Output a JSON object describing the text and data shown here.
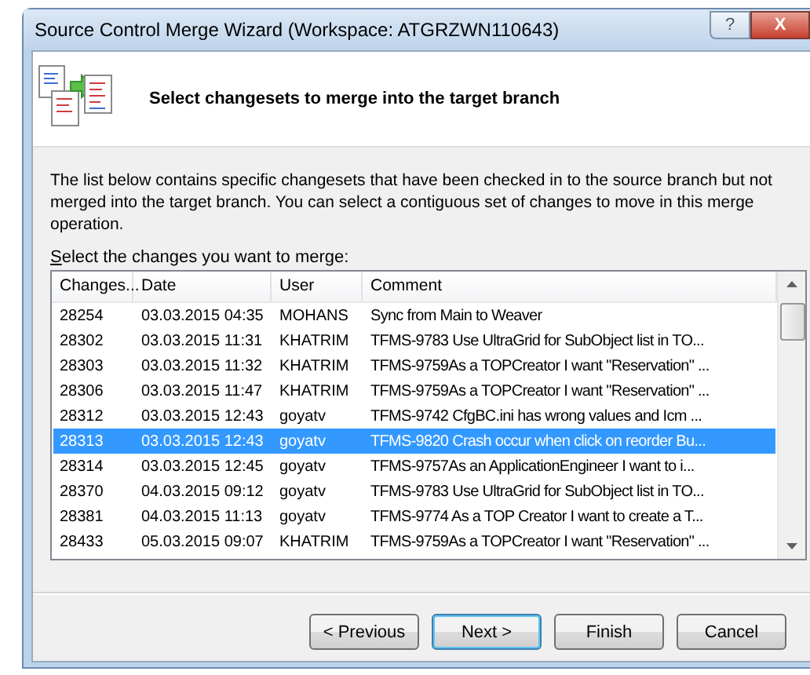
{
  "window": {
    "title": "Source Control Merge Wizard (Workspace: ATGRZWN110643)",
    "help_button": "?",
    "close_button": "X"
  },
  "header": {
    "title": "Select changesets to merge into the target branch"
  },
  "description": "The list below contains specific changesets that have been checked in to the source branch but not merged into the target branch. You can select a contiguous set of changes to move in this merge operation.",
  "list_label": "Select the changes you want to merge:",
  "table": {
    "columns": [
      "Changes...",
      "Date",
      "User",
      "Comment"
    ],
    "rows": [
      {
        "cells": [
          "28254",
          "03.03.2015 04:35",
          "MOHANS",
          "Sync from Main to Weaver"
        ],
        "selected": false
      },
      {
        "cells": [
          "28302",
          "03.03.2015 11:31",
          "KHATRIM",
          "TFMS-9783 Use UltraGrid for SubObject list in TO..."
        ],
        "selected": false
      },
      {
        "cells": [
          "28303",
          "03.03.2015 11:32",
          "KHATRIM",
          "TFMS-9759As a TOPCreator I want \"Reservation\" ..."
        ],
        "selected": false
      },
      {
        "cells": [
          "28306",
          "03.03.2015 11:47",
          "KHATRIM",
          "TFMS-9759As a TOPCreator I want \"Reservation\" ..."
        ],
        "selected": false
      },
      {
        "cells": [
          "28312",
          "03.03.2015 12:43",
          "goyatv",
          "TFMS-9742 CfgBC.ini has wrong values and Icm ..."
        ],
        "selected": false
      },
      {
        "cells": [
          "28313",
          "03.03.2015 12:43",
          "goyatv",
          "TFMS-9820 Crash occur when click on reorder Bu..."
        ],
        "selected": true
      },
      {
        "cells": [
          "28314",
          "03.03.2015 12:45",
          "goyatv",
          "TFMS-9757As an ApplicationEngineer I want to i..."
        ],
        "selected": false
      },
      {
        "cells": [
          "28370",
          "04.03.2015 09:12",
          "goyatv",
          "TFMS-9783 Use UltraGrid for SubObject list in TO..."
        ],
        "selected": false
      },
      {
        "cells": [
          "28381",
          "04.03.2015 11:13",
          "goyatv",
          "TFMS-9774 As a TOP Creator I want to create a T..."
        ],
        "selected": false
      },
      {
        "cells": [
          "28433",
          "05.03.2015 09:07",
          "KHATRIM",
          "TFMS-9759As a TOPCreator I want \"Reservation\" ..."
        ],
        "selected": false
      }
    ]
  },
  "buttons": [
    {
      "label": "< Previous",
      "default": false
    },
    {
      "label": "Next >",
      "default": true
    },
    {
      "label": "Finish",
      "default": false
    },
    {
      "label": "Cancel",
      "default": false
    }
  ]
}
